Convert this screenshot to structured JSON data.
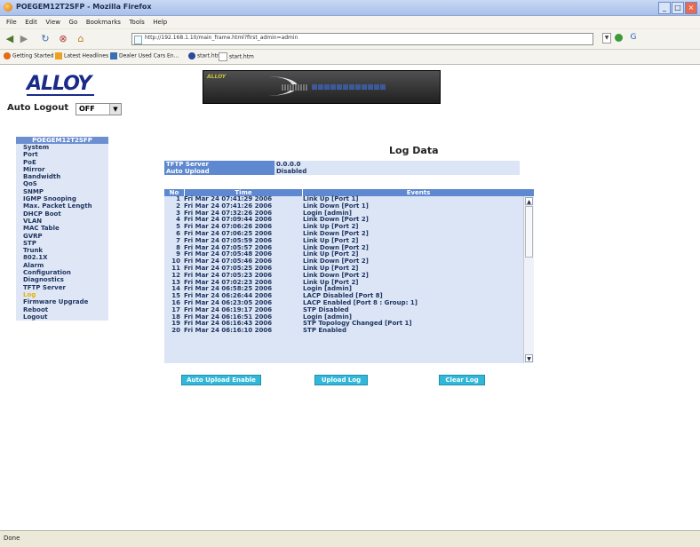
{
  "window": {
    "title": "POEGEM12T2SFP - Mozilla Firefox"
  },
  "menu": [
    "File",
    "Edit",
    "View",
    "Go",
    "Bookmarks",
    "Tools",
    "Help"
  ],
  "address": {
    "url": "http://192.168.1.10/main_frame.html?first_admin=admin"
  },
  "bookmarks": [
    "Getting Started",
    "Latest Headlines",
    "Dealer Used Cars En...",
    "start.htm",
    "start.htm"
  ],
  "logo": {
    "text": "ALLOY"
  },
  "auto_logout": {
    "label": "Auto Logout",
    "value": "OFF"
  },
  "sidebar": {
    "header": "POEGEM12T2SFP",
    "items": [
      {
        "label": "System"
      },
      {
        "label": "Port"
      },
      {
        "label": "PoE"
      },
      {
        "label": "Mirror"
      },
      {
        "label": "Bandwidth"
      },
      {
        "label": "QoS"
      },
      {
        "label": "SNMP"
      },
      {
        "label": "IGMP Snooping"
      },
      {
        "label": "Max. Packet Length"
      },
      {
        "label": "DHCP Boot"
      },
      {
        "label": "VLAN"
      },
      {
        "label": "MAC Table"
      },
      {
        "label": "GVRP"
      },
      {
        "label": "STP"
      },
      {
        "label": "Trunk"
      },
      {
        "label": "802.1X"
      },
      {
        "label": "Alarm"
      },
      {
        "label": "Configuration"
      },
      {
        "label": "Diagnostics"
      },
      {
        "label": "TFTP Server"
      },
      {
        "label": "Log",
        "active": true
      },
      {
        "label": "Firmware Upgrade"
      },
      {
        "label": "Reboot"
      },
      {
        "label": "Logout"
      }
    ]
  },
  "page": {
    "title": "Log Data"
  },
  "info": [
    {
      "label": "TFTP Server",
      "value": "0.0.0.0"
    },
    {
      "label": "Auto Upload",
      "value": "Disabled"
    }
  ],
  "log": {
    "headers": {
      "no": "No",
      "time": "Time",
      "events": "Events"
    },
    "rows": [
      {
        "no": "1",
        "time": "Fri Mar 24 07:41:29 2006",
        "event": "Link Up [Port 1]"
      },
      {
        "no": "2",
        "time": "Fri Mar 24 07:41:26 2006",
        "event": "Link Down [Port 1]"
      },
      {
        "no": "3",
        "time": "Fri Mar 24 07:32:26 2006",
        "event": "Login [admin]"
      },
      {
        "no": "4",
        "time": "Fri Mar 24 07:09:44 2006",
        "event": "Link Down [Port 2]"
      },
      {
        "no": "5",
        "time": "Fri Mar 24 07:06:26 2006",
        "event": "Link Up [Port 2]"
      },
      {
        "no": "6",
        "time": "Fri Mar 24 07:06:25 2006",
        "event": "Link Down [Port 2]"
      },
      {
        "no": "7",
        "time": "Fri Mar 24 07:05:59 2006",
        "event": "Link Up [Port 2]"
      },
      {
        "no": "8",
        "time": "Fri Mar 24 07:05:57 2006",
        "event": "Link Down [Port 2]"
      },
      {
        "no": "9",
        "time": "Fri Mar 24 07:05:48 2006",
        "event": "Link Up [Port 2]"
      },
      {
        "no": "10",
        "time": "Fri Mar 24 07:05:46 2006",
        "event": "Link Down [Port 2]"
      },
      {
        "no": "11",
        "time": "Fri Mar 24 07:05:25 2006",
        "event": "Link Up [Port 2]"
      },
      {
        "no": "12",
        "time": "Fri Mar 24 07:05:23 2006",
        "event": "Link Down [Port 2]"
      },
      {
        "no": "13",
        "time": "Fri Mar 24 07:02:23 2006",
        "event": "Link Up [Port 2]"
      },
      {
        "no": "14",
        "time": "Fri Mar 24 06:58:25 2006",
        "event": "Login [admin]"
      },
      {
        "no": "15",
        "time": "Fri Mar 24 06:26:44 2006",
        "event": "LACP Disabled [Port 8]"
      },
      {
        "no": "16",
        "time": "Fri Mar 24 06:23:05 2006",
        "event": "LACP Enabled [Port 8 : Group: 1]"
      },
      {
        "no": "17",
        "time": "Fri Mar 24 06:19:17 2006",
        "event": "STP Disabled"
      },
      {
        "no": "18",
        "time": "Fri Mar 24 06:16:51 2006",
        "event": "Login [admin]"
      },
      {
        "no": "19",
        "time": "Fri Mar 24 06:16:43 2006",
        "event": "STP Topology Changed [Port 1]"
      },
      {
        "no": "20",
        "time": "Fri Mar 24 06:16:10 2006",
        "event": "STP Enabled"
      }
    ]
  },
  "buttons": {
    "auto_upload": "Auto Upload Enable",
    "upload_log": "Upload Log",
    "clear_log": "Clear Log"
  },
  "status": {
    "text": "Done"
  }
}
